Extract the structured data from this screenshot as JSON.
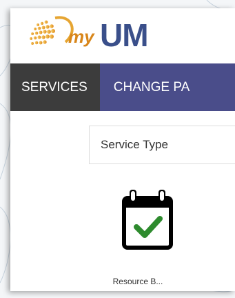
{
  "header": {
    "logo": {
      "part1": "my",
      "part2": "UM"
    }
  },
  "nav": {
    "items": [
      {
        "label": "SERVICES"
      },
      {
        "label": "CHANGE PA"
      }
    ]
  },
  "filters": {
    "service_type": "Service Type"
  },
  "services": [
    {
      "label": "Resource B...",
      "icon": "calendar-check-icon"
    }
  ],
  "colors": {
    "nav_active": "#3c3c3c",
    "nav_bar": "#4a4d8a",
    "check": "#2e8b2e",
    "logo_orange": "#d8861a",
    "logo_blue": "#3a4f8a"
  }
}
